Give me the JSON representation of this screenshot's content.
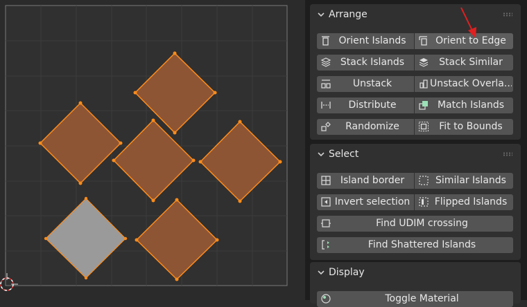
{
  "uv_editor": {
    "islands": [
      {
        "id": "i1",
        "state": "unselected"
      },
      {
        "id": "i2",
        "state": "selected"
      },
      {
        "id": "i3",
        "state": "selected"
      },
      {
        "id": "i4",
        "state": "selected"
      },
      {
        "id": "i5",
        "state": "selected"
      },
      {
        "id": "i6",
        "state": "selected"
      }
    ],
    "colors": {
      "selected_fill": "#8e5535",
      "selected_edge": "#ff8c1a",
      "unselected_fill": "#9a9a9a",
      "grid": "#3d3d3d",
      "background": "#2b2b2b"
    }
  },
  "panels": {
    "arrange": {
      "title": "Arrange",
      "buttons": [
        {
          "label": "Orient Islands",
          "icon": "orient-islands-icon"
        },
        {
          "label": "Orient to Edge",
          "icon": "orient-edge-icon",
          "highlighted": true
        },
        {
          "label": "Stack Islands",
          "icon": "stack-icon"
        },
        {
          "label": "Stack Similar",
          "icon": "stack-similar-icon"
        },
        {
          "label": "Unstack",
          "icon": "unstack-icon"
        },
        {
          "label": "Unstack Overla...",
          "icon": "unstack-overlap-icon"
        },
        {
          "label": "Distribute",
          "icon": "distribute-icon"
        },
        {
          "label": "Match Islands",
          "icon": "match-islands-icon"
        },
        {
          "label": "Randomize",
          "icon": "randomize-icon"
        },
        {
          "label": "Fit to Bounds",
          "icon": "fit-bounds-icon"
        }
      ]
    },
    "select": {
      "title": "Select",
      "buttons": [
        {
          "label": "Island border",
          "icon": "island-border-icon"
        },
        {
          "label": "Similar Islands",
          "icon": "similar-islands-icon"
        },
        {
          "label": "Invert selection",
          "icon": "invert-selection-icon"
        },
        {
          "label": "Flipped Islands",
          "icon": "flipped-islands-icon"
        },
        {
          "label": "Find UDIM crossing",
          "icon": "udim-crossing-icon"
        },
        {
          "label": "Find Shattered Islands",
          "icon": "shattered-islands-icon"
        }
      ]
    },
    "display": {
      "title": "Display",
      "buttons": [
        {
          "label": "Toggle Material",
          "icon": "material-icon"
        }
      ]
    }
  },
  "annotation": {
    "type": "arrow",
    "color": "#e02020",
    "points_to": "Orient to Edge"
  }
}
